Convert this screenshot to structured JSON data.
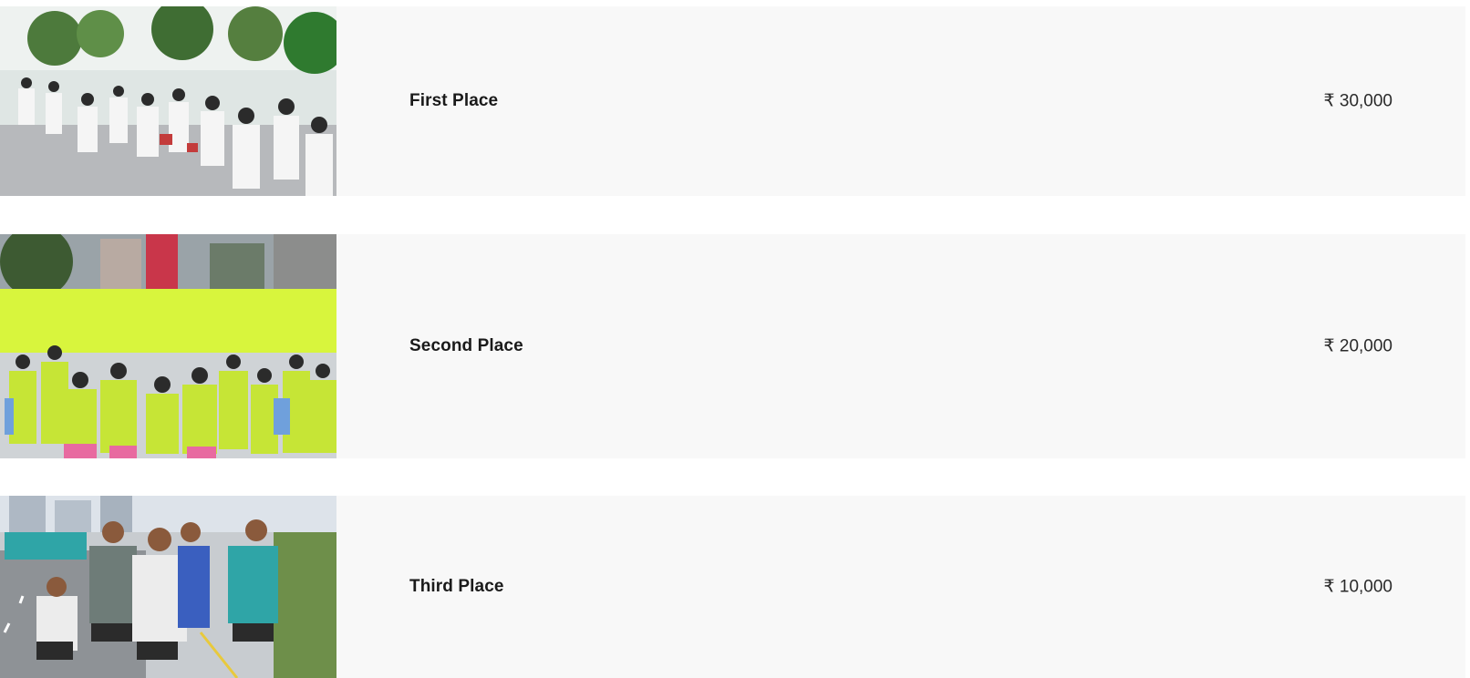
{
  "prizes": [
    {
      "place": "First Place",
      "amount": "₹ 30,000",
      "photo_icon": "marathon-runners-photo"
    },
    {
      "place": "Second Place",
      "amount": "₹ 20,000",
      "photo_icon": "marathon-crowd-photo"
    },
    {
      "place": "Third Place",
      "amount": "₹ 10,000",
      "photo_icon": "marathon-road-runners-photo"
    }
  ],
  "colors": {
    "row_background": "#f8f8f8",
    "title_text": "#1a1a1a",
    "amount_text": "#2a2a2a"
  }
}
